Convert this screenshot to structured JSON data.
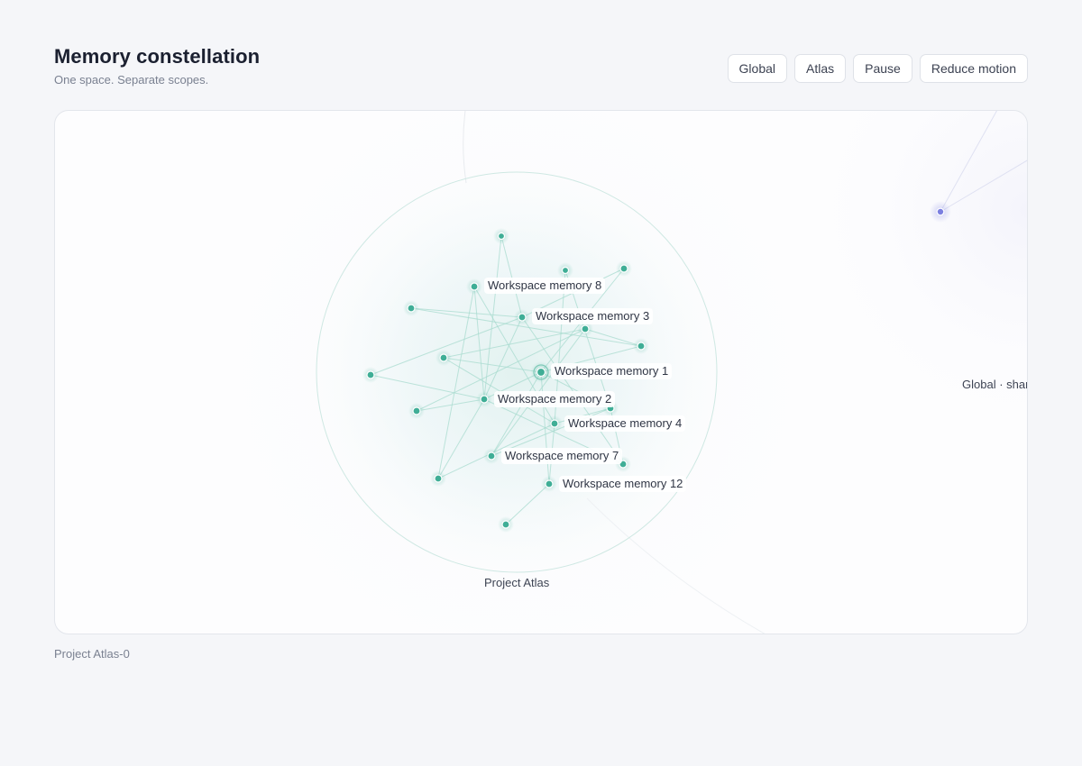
{
  "header": {
    "title": "Memory constellation",
    "subtitle": "One space. Separate scopes."
  },
  "toolbar": {
    "global_label": "Global",
    "atlas_label": "Atlas",
    "pause_label": "Pause",
    "reduce_motion_label": "Reduce motion"
  },
  "constellation": {
    "cluster_label": "Project Atlas",
    "global_label": "Global · shar",
    "colors": {
      "project_node": "#3fae96",
      "global_node": "#7b7fe0",
      "edge": "#9fd6c8",
      "ring": "#cfe8e3"
    },
    "labels": {
      "m1": "Workspace memory 1",
      "m2": "Workspace memory 2",
      "m3": "Workspace memory 3",
      "m4": "Workspace memory 4",
      "m7": "Workspace memory 7",
      "m8": "Workspace memory 8",
      "m12": "Workspace memory 12"
    }
  },
  "footer": {
    "status": "Project Atlas-0"
  }
}
